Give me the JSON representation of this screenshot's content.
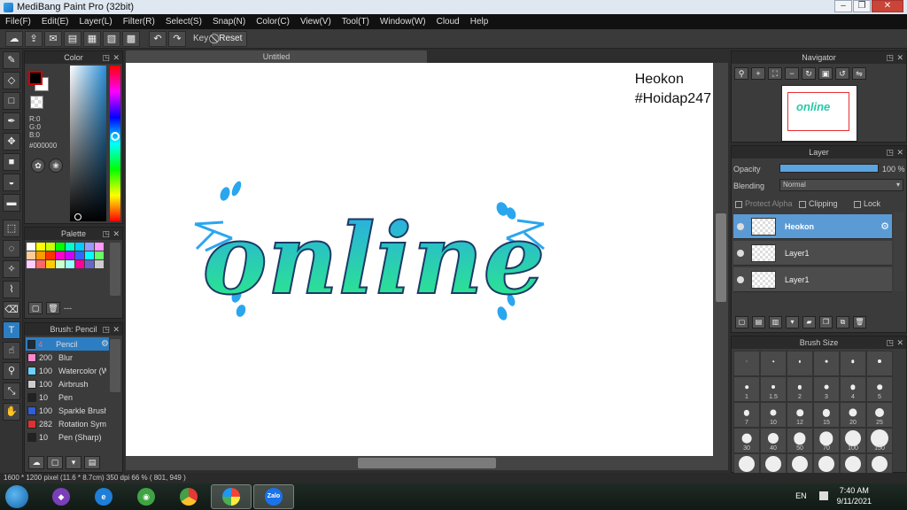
{
  "window": {
    "title": "MediBang Paint Pro (32bit)"
  },
  "menu": [
    "File(F)",
    "Edit(E)",
    "Layer(L)",
    "Filter(R)",
    "Select(S)",
    "Snap(N)",
    "Color(C)",
    "View(V)",
    "Tool(T)",
    "Window(W)",
    "Cloud",
    "Help"
  ],
  "toolbar": {
    "key_label": "Key",
    "reset_label": "Reset"
  },
  "color_panel": {
    "title": "Color",
    "r": "R:0",
    "g": "G:0",
    "b": "B:0",
    "hex": "#000000",
    "foreground": "#000000",
    "background": "#ffffff"
  },
  "palette_panel": {
    "title": "Palette",
    "dash": "---",
    "colors": [
      "#ffffff",
      "#ffff00",
      "#ccff00",
      "#00ff00",
      "#00ffcc",
      "#00ccff",
      "#9999ff",
      "#ff99ff",
      "#ffcc99",
      "#ff9900",
      "#ff3300",
      "#ff00cc",
      "#cc00ff",
      "#3366ff",
      "#00ffff",
      "#66ff66",
      "#ffccff",
      "#ff6666",
      "#ffcc00",
      "#ccffcc",
      "#99ffff",
      "#ff0099",
      "#6666cc",
      "#cccccc"
    ]
  },
  "brush_panel": {
    "title": "Brush: Pencil",
    "items": [
      {
        "size": "4",
        "name": "Pencil",
        "color": "#1c2b3b",
        "selected": true
      },
      {
        "size": "200",
        "name": "Blur",
        "color": "#ff88cc",
        "selected": false
      },
      {
        "size": "100",
        "name": "Watercolor (W",
        "color": "#6fd0ff",
        "selected": false
      },
      {
        "size": "100",
        "name": "Airbrush",
        "color": "#cccccc",
        "selected": false
      },
      {
        "size": "10",
        "name": "Pen",
        "color": "#222222",
        "selected": false
      },
      {
        "size": "100",
        "name": "Sparkle Brush",
        "color": "#2f5fd8",
        "selected": false
      },
      {
        "size": "282",
        "name": "Rotation Sym",
        "color": "#e03030",
        "selected": false
      },
      {
        "size": "10",
        "name": "Pen (Sharp)",
        "color": "#222222",
        "selected": false
      }
    ]
  },
  "document": {
    "tab": "Untitled",
    "note_line1": "Heokon",
    "note_line2": "#Hoidap247",
    "art_text": "online"
  },
  "navigator": {
    "title": "Navigator",
    "thumb_text": "online"
  },
  "layer_panel": {
    "title": "Layer",
    "opacity_label": "Opacity",
    "opacity_value": "100 %",
    "opacity": 1.0,
    "blending_label": "Blending",
    "blending_value": "Normal",
    "protect_alpha": "Protect Alpha",
    "clipping": "Clipping",
    "lock": "Lock",
    "layers": [
      {
        "name": "Heokon",
        "selected": true
      },
      {
        "name": "Layer1",
        "selected": false
      },
      {
        "name": "Layer1",
        "selected": false
      }
    ]
  },
  "brush_size_panel": {
    "title": "Brush Size",
    "sizes": [
      "",
      "",
      "",
      "",
      "",
      "",
      "1",
      "1.5",
      "2",
      "3",
      "4",
      "5",
      "7",
      "10",
      "12",
      "15",
      "20",
      "25",
      "30",
      "40",
      "50",
      "70",
      "100",
      "150",
      "",
      "",
      "",
      "",
      "",
      ""
    ]
  },
  "status": {
    "text": "1600 * 1200 pixel  (11.6 * 8.7cm)  350 dpi  66 %  ( 801, 949 )"
  },
  "taskbar": {
    "lang": "EN",
    "time": "7:40 AM",
    "date": "9/11/2021",
    "zalo": "Zalo"
  }
}
